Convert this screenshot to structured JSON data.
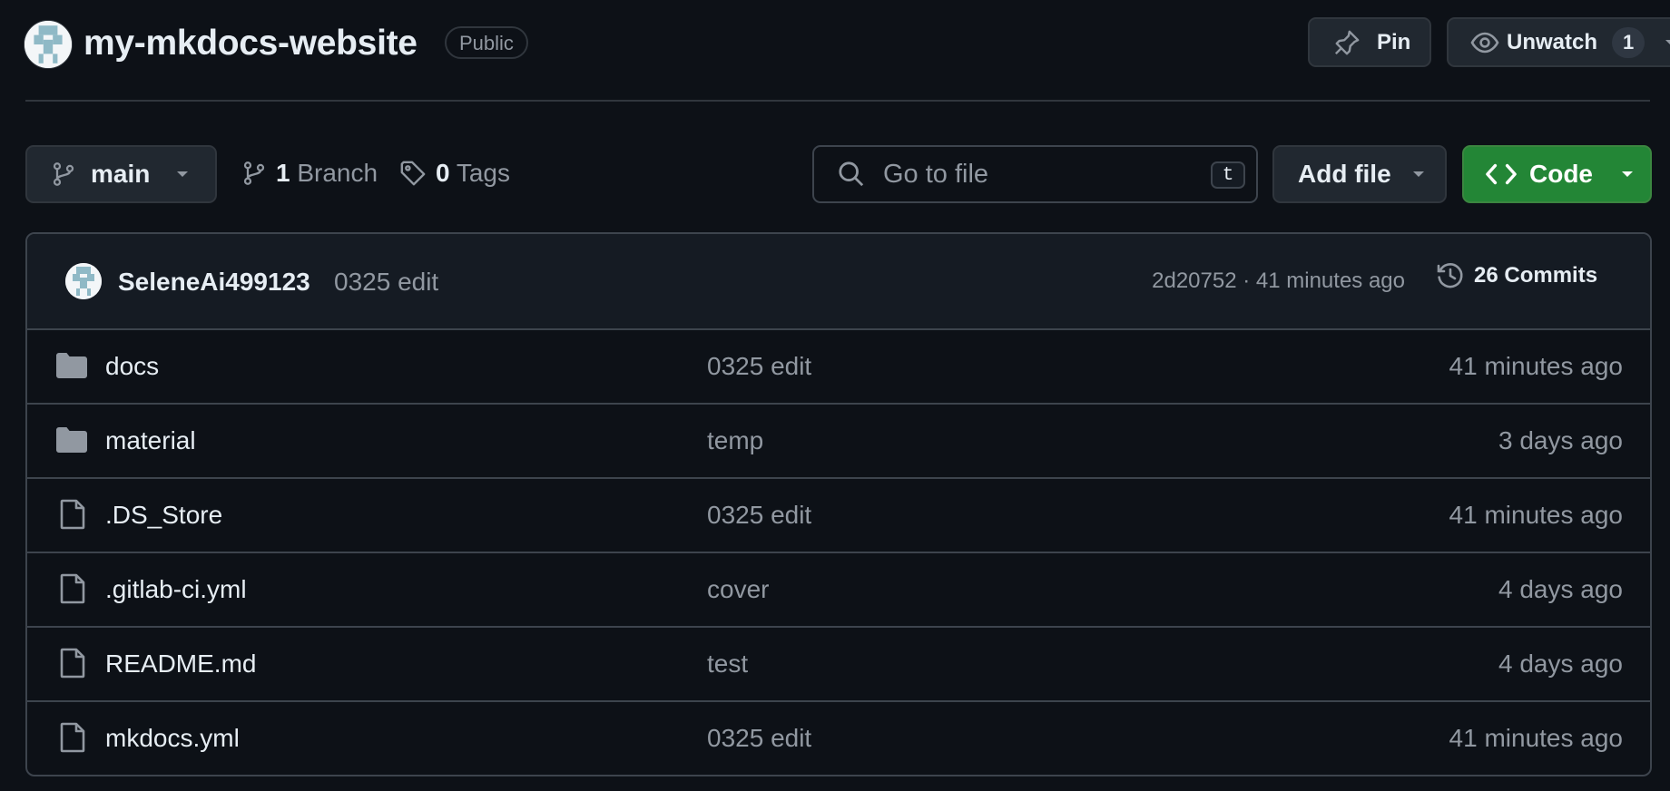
{
  "header": {
    "repo_name": "my-mkdocs-website",
    "visibility": "Public",
    "pin_label": "Pin",
    "watch_label": "Unwatch",
    "watch_count": "1"
  },
  "toolbar": {
    "branch": "main",
    "branch_count": "1",
    "branch_label": "Branch",
    "tag_count": "0",
    "tag_label": "Tags",
    "search_placeholder": "Go to file",
    "search_shortcut": "t",
    "add_file_label": "Add file",
    "code_label": "Code"
  },
  "latest_commit": {
    "author": "SeleneAi499123",
    "message": "0325 edit",
    "meta": "2d20752 · 41 minutes ago",
    "commits_label": "26 Commits"
  },
  "files": [
    {
      "name": "docs",
      "type": "folder",
      "message": "0325 edit",
      "time": "41 minutes ago"
    },
    {
      "name": "material",
      "type": "folder",
      "message": "temp",
      "time": "3 days ago"
    },
    {
      "name": ".DS_Store",
      "type": "file",
      "message": "0325 edit",
      "time": "41 minutes ago"
    },
    {
      "name": ".gitlab-ci.yml",
      "type": "file",
      "message": "cover",
      "time": "4 days ago"
    },
    {
      "name": "README.md",
      "type": "file",
      "message": "test",
      "time": "4 days ago"
    },
    {
      "name": "mkdocs.yml",
      "type": "file",
      "message": "0325 edit",
      "time": "41 minutes ago"
    }
  ],
  "icons": {
    "folder": "folder-icon",
    "file": "file-icon"
  },
  "colors": {
    "background": "#0d1117",
    "border": "#3d444d",
    "code_button": "#238636",
    "muted_text": "#9198a1"
  }
}
